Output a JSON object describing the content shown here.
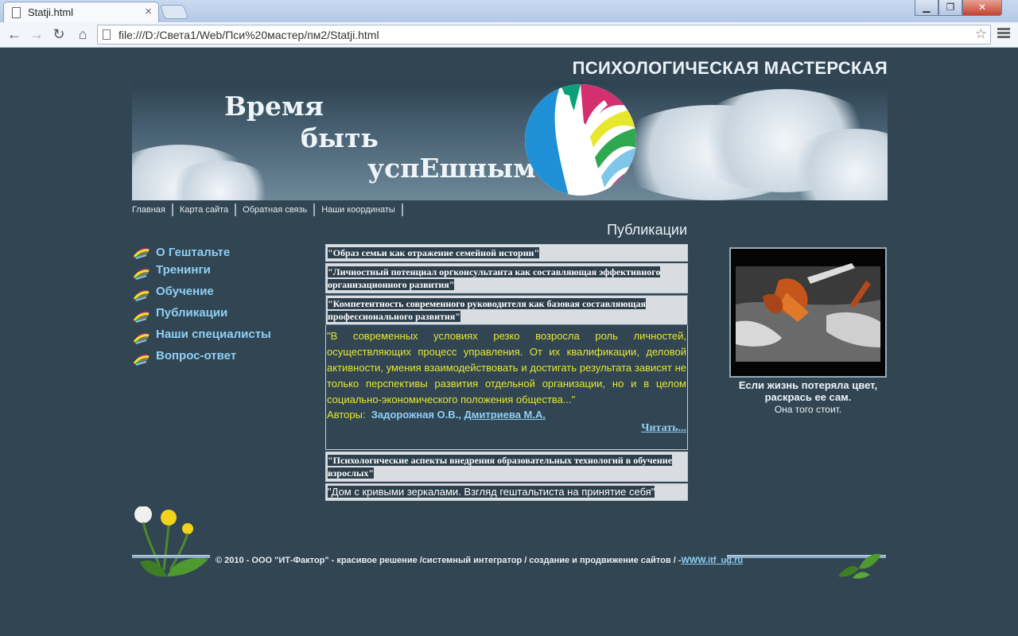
{
  "browser": {
    "tab_title": "Statji.html",
    "tab_close": "×",
    "url": "file:///D:/Света1/Web/Пси%20мастер/пм2/Statji.html"
  },
  "site": {
    "title": "ПСИХОЛОГИЧЕСКАЯ МАСТЕРСКАЯ",
    "slogan": [
      "Время",
      "быть",
      "успЕшным"
    ]
  },
  "topnav": [
    "Главная",
    "Карта сайта",
    "Обратная связь",
    "Наши координаты"
  ],
  "sidebar": [
    {
      "label": "О Гештальте"
    },
    {
      "label": "Тренинги"
    },
    {
      "label": "Обучение"
    },
    {
      "label": "Публикации"
    },
    {
      "label": "Наши специалисты"
    },
    {
      "label": "Вопрос-ответ"
    }
  ],
  "section_title": "Публикации",
  "publications": [
    {
      "title": "\"Образ семьи как отражение семейной истории\""
    },
    {
      "title": "\"Личностный потенциал оргконсультанта как составляющая эффективного организационного развития\""
    },
    {
      "title": "\"Компетентность современного руководителя как базовая составляющая профессионального развития\"",
      "abstract": "\"В современных условиях резко возросла роль личностей, осуществляющих процесс управления. От их квалификации, деловой активности, умения взаимодействовать и достигать результата зависят не только перспективы развития отдельной организации, но и в целом социально-экономического положения общества...\"",
      "authors_label": "Авторы:",
      "authors": [
        "Задорожная О.В.",
        "Дмитриева М.А."
      ],
      "authors_sep": ",",
      "read_more": "Читать..."
    },
    {
      "title": "\"Психологические аспекты внедрения образовательных технологий в обучение взрослых\""
    },
    {
      "title": "\"Дом с кривыми зеркалами. Взгляд гештальтиста на принятие себя\""
    }
  ],
  "aside": {
    "caption_line1": "Если жизнь потеряла цвет, раскрась ее сам.",
    "caption_line2": "Она того стоит."
  },
  "footer": {
    "copyright": "© 2010 - ООО \"ИТ-Фактор\" - красивое решение /системный интегратор / создание и продвижение сайтов / -",
    "link": "WWW.itf_ug.ru"
  },
  "colors": {
    "page_bg": "#314552",
    "link": "#8fd0f5",
    "abstract": "#e7e82c"
  }
}
